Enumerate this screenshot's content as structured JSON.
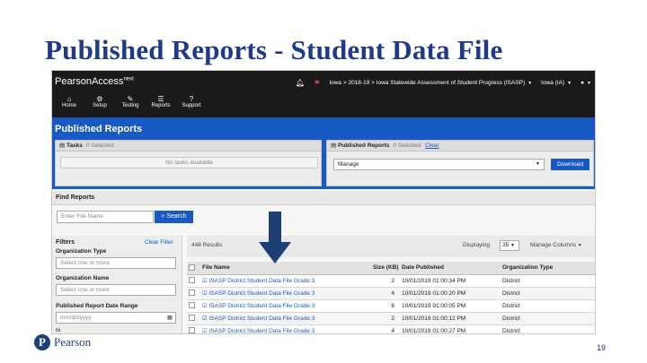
{
  "slide": {
    "title": "Published Reports - Student Data File",
    "page_number": "19",
    "logo_text": "Pearson"
  },
  "app": {
    "brand": "PearsonAccess",
    "brand_sup": "next",
    "breadcrumb": "Iowa > 2018-19 > Iowa Statewide Assessment of Student Progress (ISASP)",
    "org_selector": "Iowa (IA)",
    "nav": [
      {
        "label": "Home",
        "icon": "home-icon"
      },
      {
        "label": "Setup",
        "icon": "gear-icon"
      },
      {
        "label": "Testing",
        "icon": "pencil-icon"
      },
      {
        "label": "Reports",
        "icon": "list-icon"
      },
      {
        "label": "Support",
        "icon": "help-icon"
      }
    ],
    "page_heading": "Published Reports",
    "tasks_panel": {
      "label": "Tasks",
      "selected": "0 Selected",
      "empty_text": "No tasks available"
    },
    "pr_panel": {
      "label": "Published Reports",
      "selected": "0 Selected",
      "clear": "Clear",
      "select_value": "Manage",
      "download_label": "Download"
    },
    "find": {
      "heading": "Find Reports",
      "file_placeholder": "Enter File Name",
      "search_label": "Search"
    },
    "filters": {
      "heading": "Filters",
      "clear_label": "Clear Filter",
      "org_type_label": "Organization Type",
      "org_type_placeholder": "Select one or more",
      "org_name_label": "Organization Name",
      "org_name_placeholder": "Select one or more",
      "date_range_label": "Published Report Date Range",
      "date_placeholder": "mm/dd/yyyy",
      "to_label": "to"
    },
    "results": {
      "count": "448 Results",
      "displaying_label": "Displaying",
      "displaying_value": "25",
      "manage_columns": "Manage Columns",
      "columns": [
        "File Name",
        "Size (KB)",
        "Date Published",
        "Organization Type"
      ],
      "rows": [
        {
          "name": "ISASP District Student Data File Grade 3",
          "size": "2",
          "date": "10/01/2019 01:00:34 PM",
          "org": "District"
        },
        {
          "name": "ISASP District Student Data File Grade 3",
          "size": "4",
          "date": "10/01/2019 01:00:20 PM",
          "org": "District"
        },
        {
          "name": "ISASP District Student Data File Grade 3",
          "size": "6",
          "date": "10/01/2019 01:00:05 PM",
          "org": "District"
        },
        {
          "name": "ISASP District Student Data File Grade 3",
          "size": "2",
          "date": "10/01/2019 01:00:12 PM",
          "org": "District"
        },
        {
          "name": "ISASP District Student Data File Grade 3",
          "size": "4",
          "date": "10/01/2019 01:00:27 PM",
          "org": "District"
        }
      ]
    }
  },
  "colors": {
    "title": "#1f3a8a",
    "primary": "#1859c4",
    "topbar": "#1a1a1a",
    "arrow": "#1c3f74"
  }
}
